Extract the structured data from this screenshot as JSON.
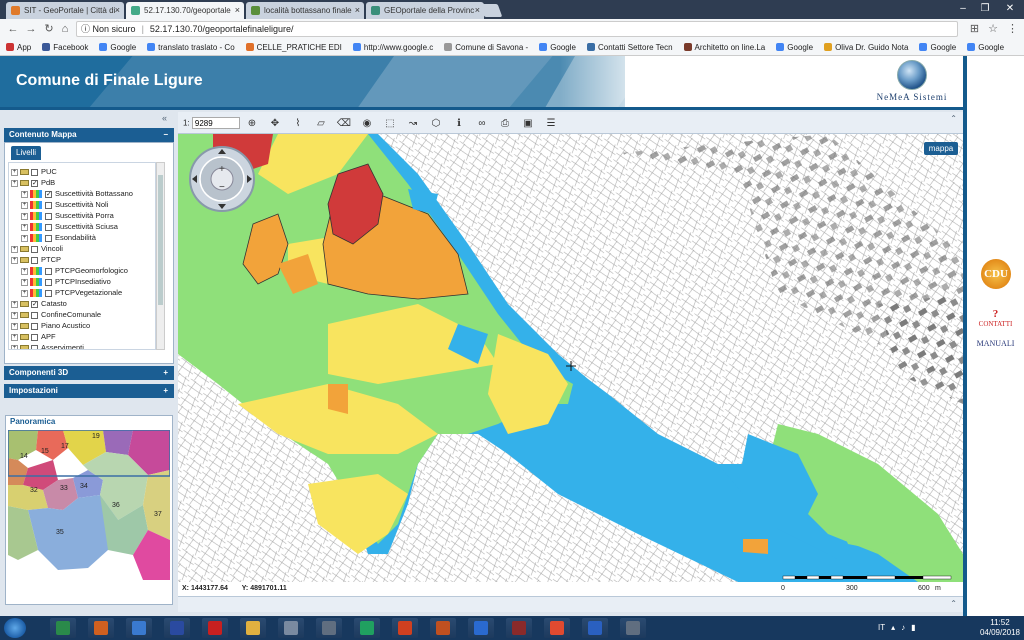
{
  "browser": {
    "tabs": [
      {
        "title": "SIT - GeoPortale | Città di",
        "favicon_color": "#e07a2a",
        "active": false
      },
      {
        "title": "52.17.130.70/geoportale",
        "favicon_color": "#4a8",
        "active": true
      },
      {
        "title": "località bottassano finale",
        "favicon_color": "#5a8f3a",
        "active": false
      },
      {
        "title": "GEOportale della Provinc",
        "favicon_color": "#3a8f7a",
        "active": false
      }
    ],
    "tab_close": "×",
    "security_label": "Non sicuro",
    "url": "52.17.130.70/geoportalefinaleligure/",
    "bookmarks": [
      {
        "label": "App",
        "color": "#c33"
      },
      {
        "label": "Facebook",
        "color": "#3b5998"
      },
      {
        "label": "Google",
        "color": "#4285f4"
      },
      {
        "label": "translato traslato - Co",
        "color": "#4285f4"
      },
      {
        "label": "CELLE_PRATICHE EDI",
        "color": "#e0702a"
      },
      {
        "label": "http://www.google.c",
        "color": "#4285f4"
      },
      {
        "label": "Comune di Savona -",
        "color": "#999"
      },
      {
        "label": "Google",
        "color": "#4285f4"
      },
      {
        "label": "Contatti Settore Tecn",
        "color": "#3a6ea5"
      },
      {
        "label": "Architetto on line.La",
        "color": "#7a3a2a"
      },
      {
        "label": "Google",
        "color": "#4285f4"
      },
      {
        "label": "Oliva Dr. Guido Nota",
        "color": "#e0a020"
      },
      {
        "label": "Google",
        "color": "#4285f4"
      },
      {
        "label": "Google",
        "color": "#4285f4"
      }
    ]
  },
  "header": {
    "title": "Comune di Finale Ligure",
    "logo_text": "NeMeA Sistemi"
  },
  "sidebar": {
    "contenuto_title": "Contenuto Mappa",
    "contenuto_toggle": "−",
    "tab_label": "Livelli",
    "layers": [
      {
        "label": "PUC",
        "level": 0,
        "type": "folder",
        "checked": false
      },
      {
        "label": "PdB",
        "level": 0,
        "type": "folder",
        "checked": true
      },
      {
        "label": "Suscettività Bottassano",
        "level": 1,
        "type": "legend",
        "checked": true
      },
      {
        "label": "Suscettività Noli",
        "level": 1,
        "type": "legend",
        "checked": false
      },
      {
        "label": "Suscettività Porra",
        "level": 1,
        "type": "legend",
        "checked": false
      },
      {
        "label": "Suscettività Sciusa",
        "level": 1,
        "type": "legend",
        "checked": false
      },
      {
        "label": "Esondabilità",
        "level": 1,
        "type": "legend",
        "checked": false
      },
      {
        "label": "Vincoli",
        "level": 0,
        "type": "folder",
        "checked": false
      },
      {
        "label": "PTCP",
        "level": 0,
        "type": "folder",
        "checked": false
      },
      {
        "label": "PTCPGeomorfologico",
        "level": 1,
        "type": "legend",
        "checked": false
      },
      {
        "label": "PTCPInsediativo",
        "level": 1,
        "type": "legend",
        "checked": false
      },
      {
        "label": "PTCPVegetazionale",
        "level": 1,
        "type": "legend",
        "checked": false
      },
      {
        "label": "Catasto",
        "level": 0,
        "type": "folder",
        "checked": true
      },
      {
        "label": "ConfineComunale",
        "level": 0,
        "type": "folder",
        "checked": false
      },
      {
        "label": "Piano Acustico",
        "level": 0,
        "type": "folder",
        "checked": false
      },
      {
        "label": "APF",
        "level": 0,
        "type": "folder",
        "checked": false
      },
      {
        "label": "Asservimenti",
        "level": 0,
        "type": "folder",
        "checked": false
      }
    ],
    "componenti_title": "Componenti 3D",
    "impostazioni_title": "Impostazioni",
    "expand_symbol": "+",
    "panoramica_title": "Panoramica",
    "panoramica_labels": [
      "19",
      "17",
      "14",
      "15",
      "32",
      "33",
      "34",
      "36",
      "35",
      "37"
    ]
  },
  "map": {
    "scale_prefix": "1:",
    "scale_value": "9289",
    "mappa_button": "mappa",
    "coord_x": "X: 1443177.64",
    "coord_y": "Y: 4891701.11",
    "scalebar_labels": [
      "0",
      "300",
      "600",
      "m"
    ],
    "tools": [
      "zoom-icon",
      "pan-icon",
      "measure-line-icon",
      "measure-area-icon",
      "erase-icon",
      "identify-icon",
      "select-icon",
      "select-line-icon",
      "select-area-icon",
      "info-icon",
      "binoculars-icon",
      "print-icon",
      "save-icon",
      "log-icon"
    ],
    "colors": {
      "red": "#d03a3a",
      "orange": "#f2a33a",
      "yellow": "#f8e45f",
      "green": "#8fe07a",
      "blue": "#34b1ea"
    }
  },
  "right_panel": {
    "cdu_label": "CDU",
    "contatti_label": "CONTATTI",
    "manuali_label": "MANUALI"
  },
  "taskbar": {
    "lang": "IT",
    "time": "11:52",
    "date": "04/09/2018"
  }
}
